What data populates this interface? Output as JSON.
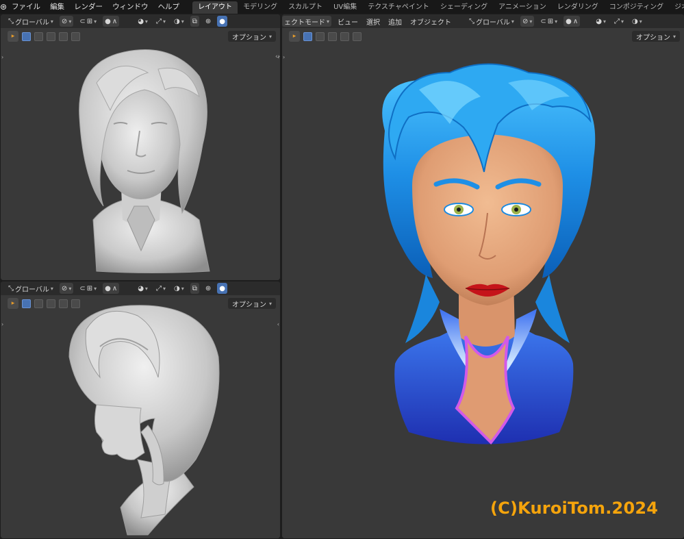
{
  "topbar": {
    "logo_icon": "blender-logo-icon",
    "menus": [
      "ファイル",
      "編集",
      "レンダー",
      "ウィンドウ",
      "ヘルプ"
    ],
    "workspaces": [
      {
        "label": "レイアウト",
        "active": true
      },
      {
        "label": "モデリング",
        "active": false
      },
      {
        "label": "スカルプト",
        "active": false
      },
      {
        "label": "UV編集",
        "active": false
      },
      {
        "label": "テクスチャペイント",
        "active": false
      },
      {
        "label": "シェーディング",
        "active": false
      },
      {
        "label": "アニメーション",
        "active": false
      },
      {
        "label": "レンダリング",
        "active": false
      },
      {
        "label": "コンポジティング",
        "active": false
      },
      {
        "label": "ジオメトリ",
        "active": false
      }
    ]
  },
  "viewports": {
    "transform_orientation": "グローバル",
    "options_label": "オプション",
    "mode_label": "ェクトモード",
    "menus": [
      "ビュー",
      "選択",
      "追加",
      "オブジェクト"
    ]
  },
  "watermark": "(C)KuroiTom.2024",
  "colors": {
    "hair": "#1e8fe6",
    "jacket": "#2f55d9",
    "collar_trim": "#d25ae8",
    "skin": "#e2a27a",
    "watermark": "#f5a40c"
  }
}
